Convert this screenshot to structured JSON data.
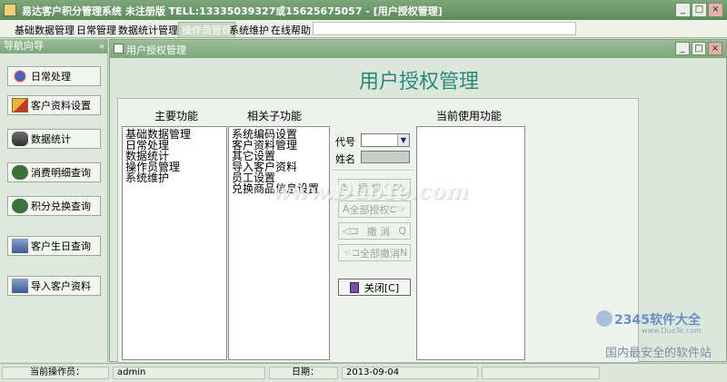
{
  "window": {
    "title": "易达客户积分管理系统  未注册版  TELL:13335039327或15625675057 - [用户授权管理]",
    "controls": [
      "_",
      "□",
      "×"
    ]
  },
  "menubar": {
    "items": [
      {
        "label": "基础数据管理"
      },
      {
        "label": "日常管理"
      },
      {
        "label": "数据统计管理"
      },
      {
        "label": "操作员管理"
      },
      {
        "label": "系统维护"
      },
      {
        "label": "在线帮助"
      }
    ]
  },
  "nav": {
    "title": "导航向导",
    "collapse": "«",
    "items": [
      {
        "label": "日常处理",
        "icon": "daily-icon"
      },
      {
        "label": "客户资料设置",
        "icon": "customer-icon"
      },
      {
        "label": "数据统计",
        "icon": "stats-icon"
      },
      {
        "label": "消费明细查询",
        "icon": "money-icon"
      },
      {
        "label": "积分兑换查询",
        "icon": "money-icon"
      },
      {
        "label": "客户生日查询",
        "icon": "user-icon"
      },
      {
        "label": "导入客户资料",
        "icon": "user-icon"
      }
    ]
  },
  "child": {
    "title": "用户授权管理",
    "controls": [
      "_",
      "□",
      "×"
    ]
  },
  "page": {
    "heading": "用户授权管理",
    "col_main": "主要功能",
    "col_sub": "相关子功能",
    "col_current": "当前使用功能",
    "main_functions": [
      "基础数据管理",
      "日常处理",
      "数据统计",
      "操作员管理",
      "系统维护"
    ],
    "sub_functions": [
      "系统编码设置",
      "客户资料管理",
      "其它设置",
      "导入客户资料",
      "员工设置",
      "兑换商品信息设置"
    ],
    "code_label": "代号",
    "name_label": "姓名",
    "buttons": {
      "grant": {
        "label": "授 权",
        "left": "S",
        "right": "⊏▷"
      },
      "grant_all": {
        "label": "全部授权",
        "left": "A",
        "right": "⊏☞"
      },
      "cancel": {
        "label": "撤 消",
        "left": "◁⊐",
        "right": "Q"
      },
      "cancel_all": {
        "label": "全部撤消",
        "left": "☜⊐",
        "right": "N"
      },
      "close": {
        "label": "关闭[C]"
      }
    }
  },
  "watermark": {
    "text": "www.DuoTe.com",
    "brand": "2345软件大全",
    "url": "www.DuoTe.com",
    "slogan": "国内最安全的软件站"
  },
  "status": {
    "operator_label": "当前操作员：",
    "operator_value": "admin",
    "date_label": "日期：",
    "date_value": "2013-09-04"
  }
}
